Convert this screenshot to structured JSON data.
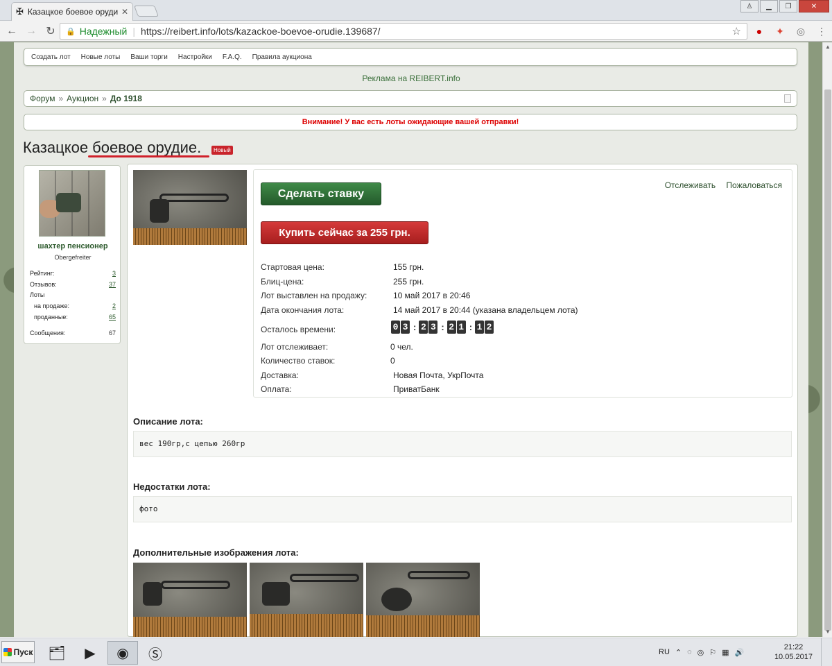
{
  "browser": {
    "tab_title": "Казацкое боевое оруди",
    "security_label": "Надежный",
    "url": "https://reibert.info/lots/kazackoe-boevoe-orudie.139687/"
  },
  "site": {
    "nav": [
      "Создать лот",
      "Новые лоты",
      "Ваши торги",
      "Настройки",
      "F.A.Q.",
      "Правила аукциона"
    ],
    "ad_text": "Реклама на REIBERT.info",
    "breadcrumbs": [
      "Форум",
      "Аукцион",
      "До 1918"
    ],
    "alert": "Внимание! У вас есть лоты ожидающие вашей отправки!"
  },
  "lot": {
    "title": "Казацкое боевое орудие.",
    "badge": "Новый",
    "bid_button": "Сделать ставку",
    "buy_button": "Купить сейчас за 255 грн.",
    "watch_link": "Отслеживать",
    "report_link": "Пожаловаться",
    "details": [
      {
        "label": "Стартовая цена:",
        "value": "155 грн."
      },
      {
        "label": "Блиц-цена:",
        "value": "255 грн."
      },
      {
        "label": "Лот выставлен на продажу:",
        "value": "10 май 2017 в 20:46"
      },
      {
        "label": "Дата окончания лота:",
        "value": "14 май 2017 в 20:44 (указана владельцем лота)"
      },
      {
        "label": "Осталось времени:",
        "value": ""
      },
      {
        "label": "Лот отслеживает:",
        "value": "0 чел."
      },
      {
        "label": "Количество ставок:",
        "value": "0"
      },
      {
        "label": "Доставка:",
        "value": "Новая Почта, УкрПочта"
      },
      {
        "label": "Оплата:",
        "value": "ПриватБанк"
      }
    ],
    "countdown": [
      "0",
      "3",
      "2",
      "3",
      "2",
      "1",
      "1",
      "2"
    ],
    "description_heading": "Описание лота:",
    "description": "вес 190гр,с цепью 260гр",
    "defects_heading": "Недостатки лота:",
    "defects": "фото",
    "extra_images_heading": "Дополнительные изображения лота:"
  },
  "seller": {
    "name": "шахтер пенсионер",
    "rank": "Obergefreiter",
    "rating_label": "Рейтинг:",
    "rating": "3",
    "reviews_label": "Отзывов:",
    "reviews": "37",
    "lots_label": "Лоты",
    "on_sale_label": "на продаже:",
    "on_sale": "2",
    "sold_label": "проданные:",
    "sold": "65",
    "messages_label": "Сообщения:",
    "messages": "67"
  },
  "taskbar": {
    "start": "Пуск",
    "lang": "RU",
    "time": "21:22",
    "date": "10.05.2017"
  },
  "colors": {
    "bid": "#2f6f38",
    "buy": "#c12a2a",
    "alert": "#dd0000",
    "link": "#2d4f2d"
  }
}
